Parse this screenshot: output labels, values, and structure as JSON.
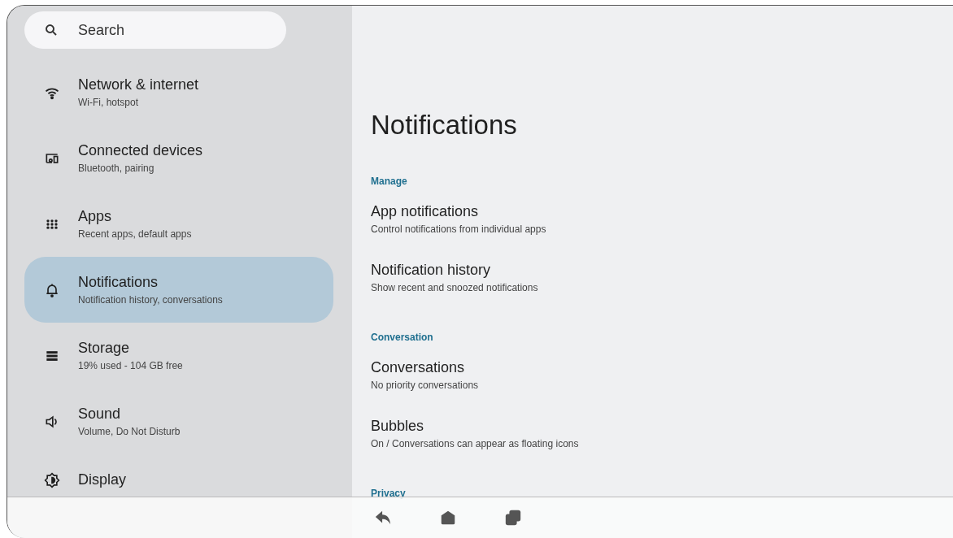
{
  "search": {
    "placeholder": "Search"
  },
  "sidebar": {
    "items": [
      {
        "kind": "wifi",
        "title": "Network & internet",
        "subtitle": "Wi-Fi, hotspot",
        "selected": false
      },
      {
        "kind": "devices",
        "title": "Connected devices",
        "subtitle": "Bluetooth, pairing",
        "selected": false
      },
      {
        "kind": "apps",
        "title": "Apps",
        "subtitle": "Recent apps, default apps",
        "selected": false
      },
      {
        "kind": "bell",
        "title": "Notifications",
        "subtitle": "Notification history, conversations",
        "selected": true
      },
      {
        "kind": "storage",
        "title": "Storage",
        "subtitle": "19% used - 104 GB free",
        "selected": false
      },
      {
        "kind": "sound",
        "title": "Sound",
        "subtitle": "Volume, Do Not Disturb",
        "selected": false
      },
      {
        "kind": "display",
        "title": "Display",
        "selected": false
      }
    ]
  },
  "main": {
    "title": "Notifications",
    "sections": [
      {
        "header": "Manage",
        "items": [
          {
            "title": "App notifications",
            "subtitle": "Control notifications from individual apps"
          },
          {
            "title": "Notification history",
            "subtitle": "Show recent and snoozed notifications"
          }
        ]
      },
      {
        "header": "Conversation",
        "items": [
          {
            "title": "Conversations",
            "subtitle": "No priority conversations"
          },
          {
            "title": "Bubbles",
            "subtitle": "On / Conversations can appear as floating icons"
          }
        ]
      },
      {
        "header": "Privacy"
      }
    ]
  }
}
